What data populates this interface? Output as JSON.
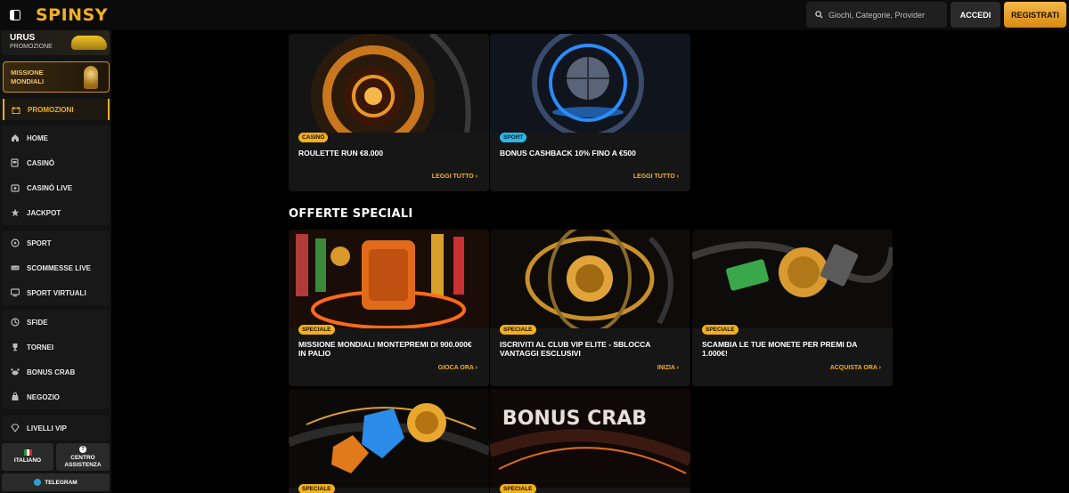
{
  "header": {
    "logo": "SPINSY",
    "search_placeholder": "Giochi, Categorie, Provider",
    "login_label": "ACCEDI",
    "register_label": "REGISTRATI",
    "brand_color": "#f2b01e"
  },
  "sidebar": {
    "promo_urus": {
      "title": "URUS",
      "subtitle": "PROMOZIONE"
    },
    "promo_mondiali": {
      "label": "MISSIONE MONDIALI"
    },
    "promotions_label": "PROMOZIONI",
    "groups": [
      {
        "items": [
          {
            "label": "HOME",
            "icon": "home-icon"
          },
          {
            "label": "CASINÒ",
            "icon": "slot-icon"
          },
          {
            "label": "CASINÒ LIVE",
            "icon": "live-casino-icon"
          },
          {
            "label": "JACKPOT",
            "icon": "jackpot-icon"
          }
        ]
      },
      {
        "items": [
          {
            "label": "SPORT",
            "icon": "ball-icon"
          },
          {
            "label": "SCOMMESSE LIVE",
            "icon": "live-icon"
          },
          {
            "label": "SPORT VIRTUALI",
            "icon": "monitor-icon"
          }
        ]
      },
      {
        "items": [
          {
            "label": "SFIDE",
            "icon": "challenge-icon"
          },
          {
            "label": "TORNEI",
            "icon": "trophy-icon"
          },
          {
            "label": "BONUS CRAB",
            "icon": "crab-icon"
          },
          {
            "label": "NEGOZIO",
            "icon": "shop-icon"
          }
        ]
      },
      {
        "items": [
          {
            "label": "LIVELLI VIP",
            "icon": "diamond-icon"
          }
        ]
      }
    ],
    "language_label": "ITALIANO",
    "help_label": "CENTRO ASSISTENZA",
    "telegram_label": "TELEGRAM"
  },
  "main": {
    "top_cards": [
      {
        "badge": "CASINÒ",
        "title": "ROULETTE RUN €8.000",
        "link": "LEGGI TUTTO"
      },
      {
        "badge": "SPORT",
        "title": "BONUS CASHBACK 10% FINO A €500",
        "link": "LEGGI TUTTO"
      }
    ],
    "section_title": "OFFERTE SPECIALI",
    "special_cards": [
      {
        "badge": "SPECIALE",
        "title": "MISSIONE MONDIALI MONTEPREMI DI 900.000€ IN PALIO",
        "link": "GIOCA ORA"
      },
      {
        "badge": "SPECIALE",
        "title": "ISCRIVITI AL CLUB VIP ELITE - SBLOCCA VANTAGGI ESCLUSIVI",
        "link": "INIZIA"
      },
      {
        "badge": "SPECIALE",
        "title": "SCAMBIA LE TUE MONETE PER PREMI DA 1.000€!",
        "link": "ACQUISTA ORA"
      }
    ],
    "bottom_cards": [
      {
        "badge": "SPECIALE",
        "image_text": ""
      },
      {
        "badge": "SPECIALE",
        "image_text": "BONUS CRAB"
      }
    ]
  }
}
